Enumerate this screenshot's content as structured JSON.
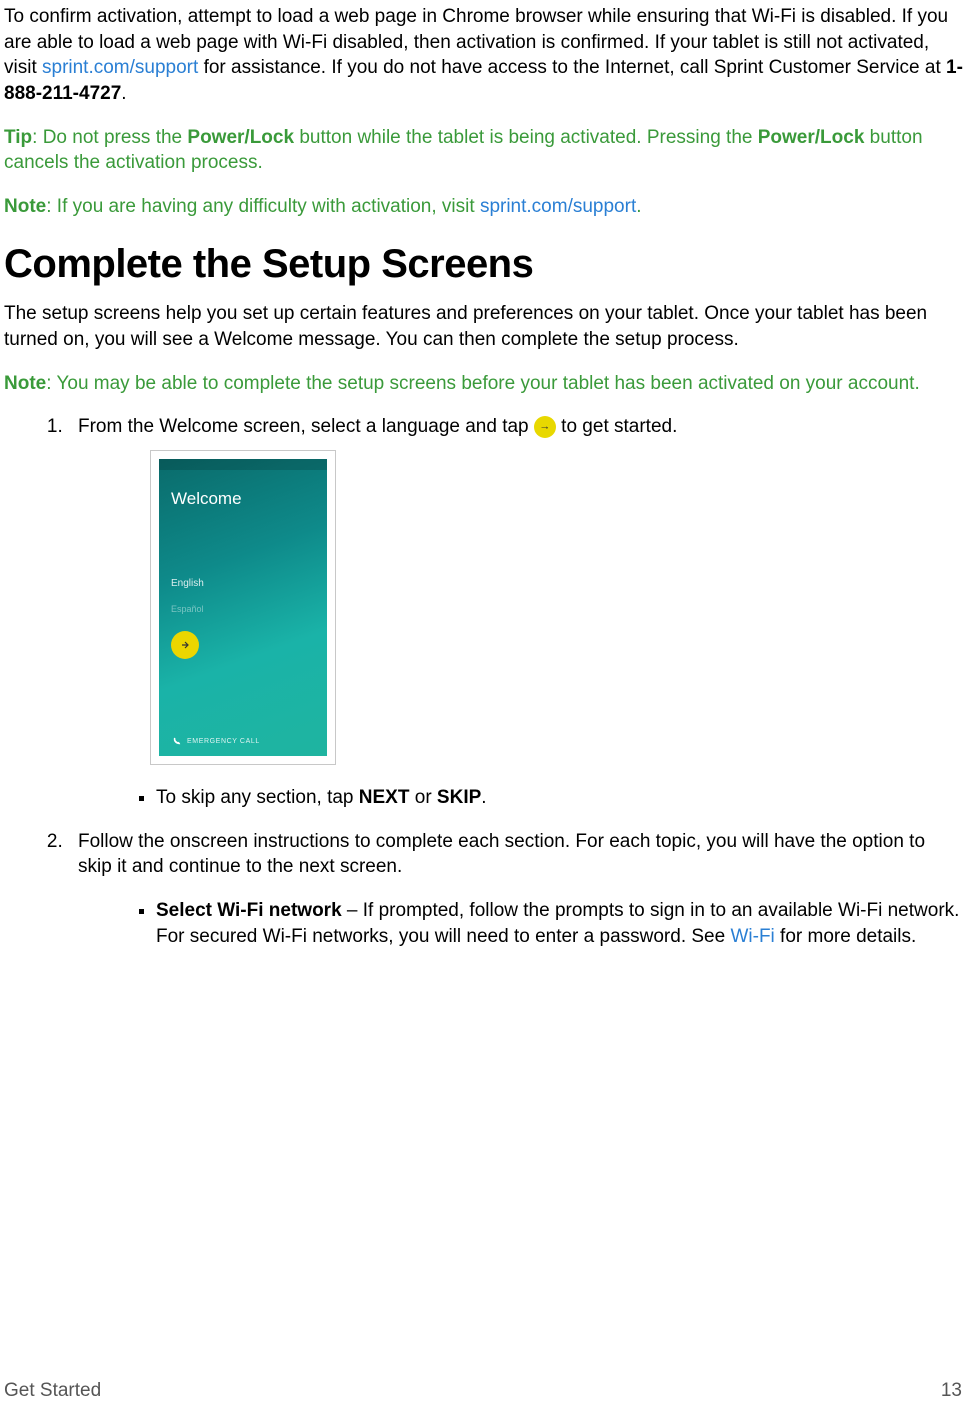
{
  "para1": {
    "pre": "To confirm activation, attempt to load a web page in Chrome browser while ensuring that Wi-Fi is disabled. If you are able to load a web page with Wi-Fi disabled, then activation is confirmed. If your tablet is still not activated, visit ",
    "link1": "sprint.com/support",
    "mid": " for assistance. If you do not have access to the Internet, call Sprint Customer Service at ",
    "phone": "1-888-211-4727",
    "post": "."
  },
  "tip": {
    "label": "Tip",
    "pre": ": Do not press the ",
    "b1": "Power/Lock",
    "mid": " button while the tablet is being activated. Pressing the ",
    "b2": "Power/Lock",
    "post": " button cancels the activation process."
  },
  "note1": {
    "label": "Note",
    "pre": ": If you are having any difficulty with activation, visit ",
    "link": "sprint.com/support",
    "post": "."
  },
  "heading": "Complete the Setup Screens",
  "intro": "The setup screens help you set up certain features and preferences on your tablet. Once your tablet has been turned on, you will see a Welcome message. You can then complete the setup process.",
  "note2": {
    "label": "Note",
    "text": ": You may be able to complete the setup screens before your tablet has been activated on your account."
  },
  "step1": {
    "pre": "From the Welcome screen, select a language and tap ",
    "post": " to get started."
  },
  "phone_mockup": {
    "title": "Welcome",
    "lang1": "English",
    "lang2": "Español",
    "emergency": "EMERGENCY CALL"
  },
  "skip": {
    "pre": "To skip any section, tap ",
    "b1": "NEXT",
    "mid": " or ",
    "b2": "SKIP",
    "post": "."
  },
  "step2": "Follow the onscreen instructions to complete each section. For each topic, you will have the option to skip it and continue to the next screen.",
  "wifi": {
    "title": "Select Wi-Fi network",
    "pre": " – If prompted, follow the prompts to sign in to an available Wi-Fi network. For secured Wi-Fi networks, you will need to enter a password. See ",
    "link": "Wi-Fi",
    "post": " for more details."
  },
  "footer": {
    "left": "Get Started",
    "right": "13"
  }
}
